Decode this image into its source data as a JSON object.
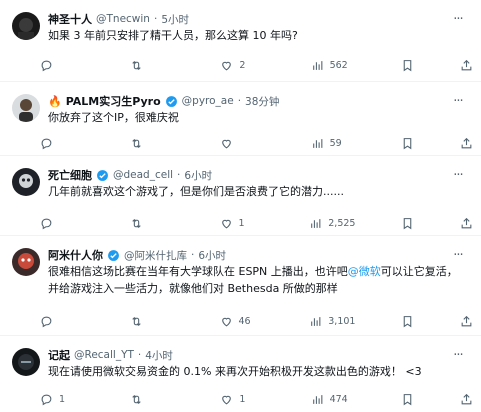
{
  "tweets": [
    {
      "name": "神圣十人",
      "handle": "@Tnecwin",
      "time": "5小时",
      "text": "如果 3 年前只安排了精干人员，那么这算 10 年吗?",
      "replies": "",
      "retweets": "",
      "likes": "2",
      "views": "562"
    },
    {
      "name": "PALM实习生Pyro",
      "prefix_emoji": "🔥",
      "handle": "@pyro_ae",
      "time": "38分钟",
      "verified": true,
      "text": "你放弃了这个IP，很难庆祝",
      "replies": "",
      "retweets": "",
      "likes": "",
      "views": "59"
    },
    {
      "name": "死亡细胞",
      "handle": "@dead_cell",
      "time": "6小时",
      "verified": true,
      "text": "几年前就喜欢这个游戏了，但是你们是否浪费了它的潜力......",
      "replies": "",
      "retweets": "",
      "likes": "1",
      "views": "2,525"
    },
    {
      "name": "阿米什人你",
      "handle": "@阿米什扎库",
      "time": "6小时",
      "verified": true,
      "text_before_link": "很难相信这场比赛在当年有大学球队在 ESPN 上播出，也许吧",
      "link_text": "@微软",
      "text_after_link": "可以让它复活，并给游戏注入一些活力，就像他们对 Bethesda 所做的那样",
      "replies": "",
      "retweets": "",
      "likes": "46",
      "views": "3,101"
    },
    {
      "name": "记起",
      "handle": "@Recall_YT",
      "time": "4小时",
      "text": "现在请使用微软交易资金的 0.1% 来再次开始积极开发这款出色的游戏！ <3",
      "replies": "1",
      "retweets": "",
      "likes": "1",
      "views": "474"
    }
  ],
  "separator_dot": "·",
  "more_glyph": "···",
  "icons": {
    "reply": "reply-icon",
    "retweet": "retweet-icon",
    "like": "heart-icon",
    "views": "views-icon",
    "bookmark": "bookmark-icon",
    "share": "share-icon",
    "verified": "verified-badge-icon"
  },
  "colors": {
    "text": "#0f1419",
    "secondary": "#536471",
    "accent": "#1d9bf0",
    "divider": "#eff3f4"
  }
}
